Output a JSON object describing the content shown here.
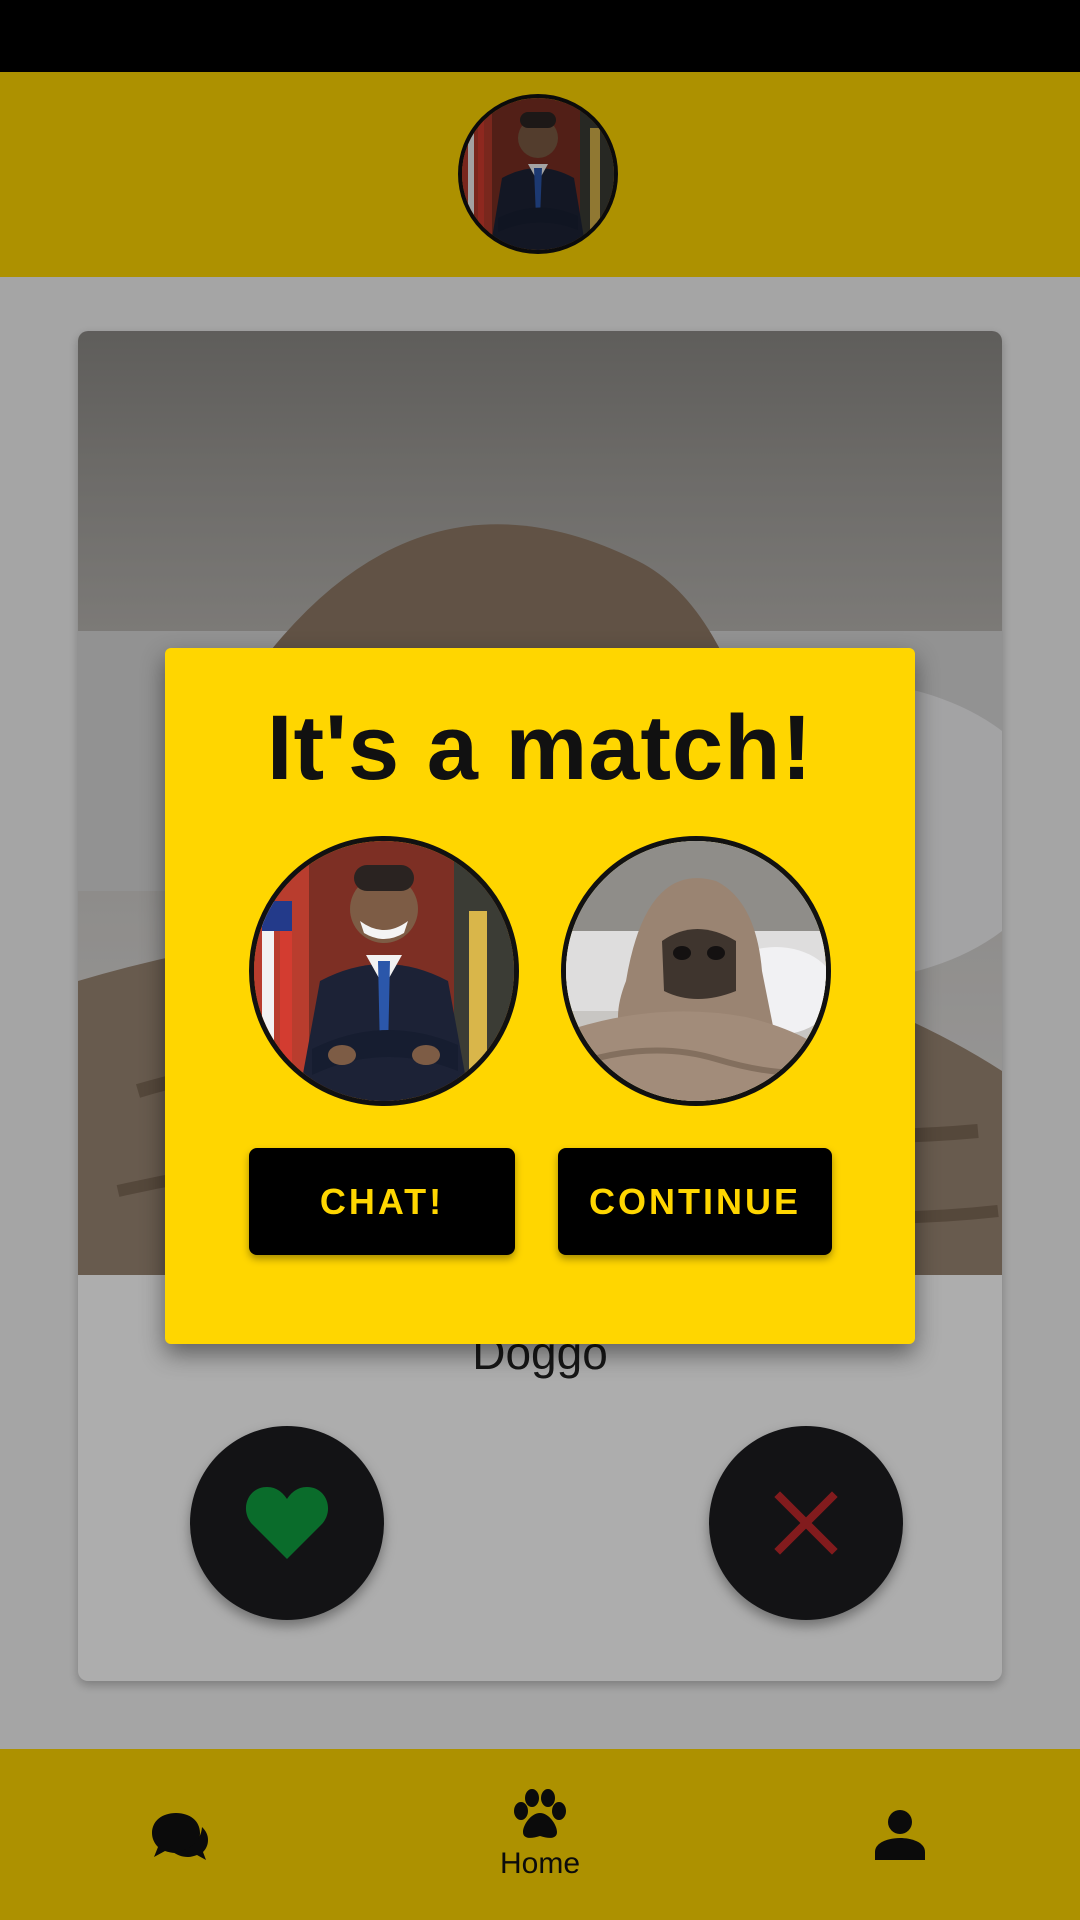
{
  "header": {
    "avatar_icon": "user-avatar-photo"
  },
  "card": {
    "name": "Doggo",
    "photo_icon": "pug-in-blanket-photo",
    "like_icon": "heart-icon",
    "nope_icon": "close-icon",
    "colors": {
      "like": "#10a040",
      "nope": "#c0282c",
      "button_bg": "#1c1d20"
    }
  },
  "dialog": {
    "title": "It's a match!",
    "chat_label": "CHAT!",
    "continue_label": "CONTINUE",
    "user_avatar_icon": "user-avatar-photo",
    "pet_avatar_icon": "pug-avatar-photo"
  },
  "bottom_nav": {
    "items": [
      {
        "id": "chats",
        "label": "",
        "icon": "chat-bubbles-icon"
      },
      {
        "id": "home",
        "label": "Home",
        "icon": "paw-icon"
      },
      {
        "id": "profile",
        "label": "",
        "icon": "person-icon"
      }
    ]
  },
  "theme": {
    "accent": "#ffd600",
    "dark": "#111111"
  }
}
